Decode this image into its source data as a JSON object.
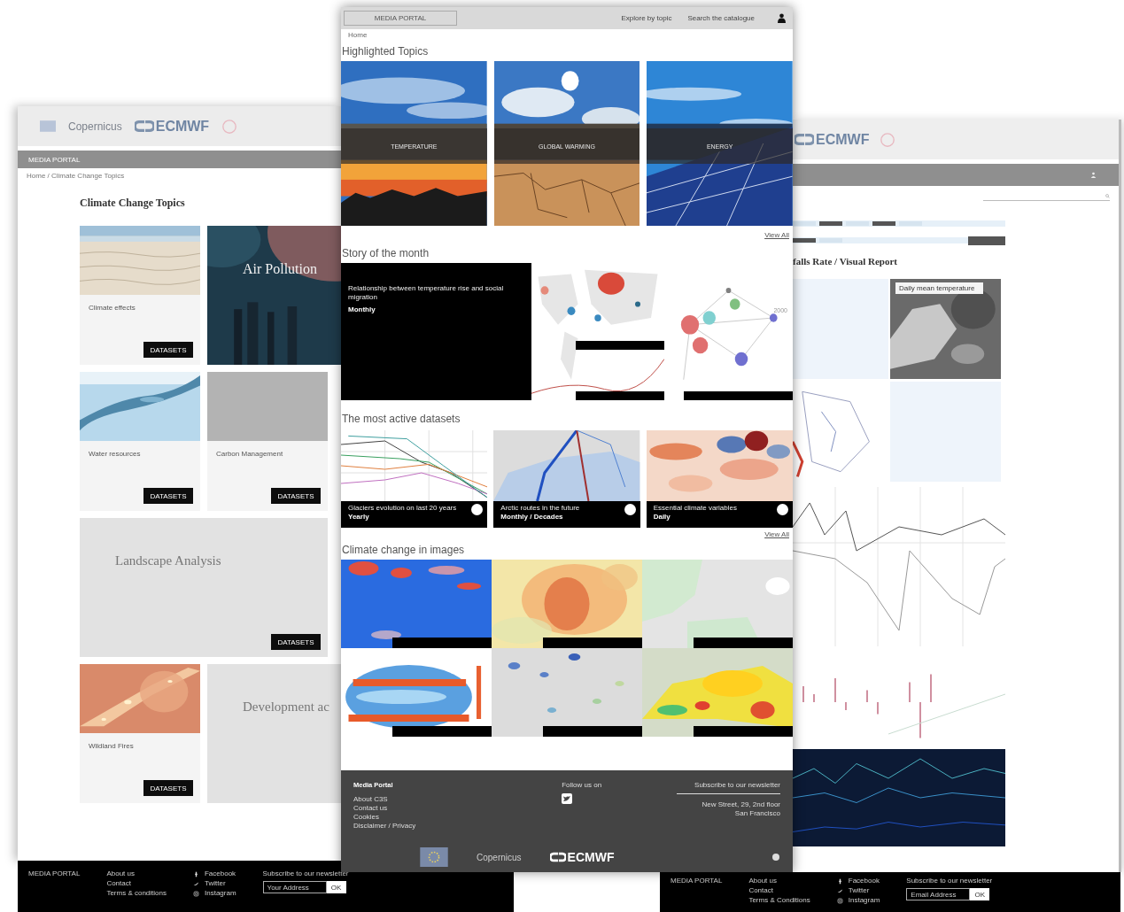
{
  "left_page": {
    "logos": [
      "Copernicus",
      "ECMWF"
    ],
    "nav": "MEDIA PORTAL",
    "breadcrumb": "Home / Climate Change Topics",
    "title": "Climate Change Topics",
    "cards": [
      {
        "title": "Climate effects",
        "button": "DATASETS"
      },
      {
        "kind": "feature",
        "title": "Air Pollution"
      },
      {
        "title": "Water resources",
        "button": "DATASETS"
      },
      {
        "kind": "placeholder",
        "title": "Carbon Management",
        "button": "DATASETS"
      },
      {
        "kind": "wide",
        "title": "Landscape Analysis",
        "button": "DATASETS"
      },
      {
        "title": "Wildland Fires",
        "button": "DATASETS"
      },
      {
        "kind": "feature",
        "title": "Development ac"
      }
    ],
    "footer": {
      "brand": "MEDIA PORTAL",
      "links": [
        "About us",
        "Contact",
        "Terms & conditions"
      ],
      "social": [
        {
          "kind": "facebook",
          "label": "Facebook"
        },
        {
          "kind": "twitter",
          "label": "Twitter"
        },
        {
          "kind": "instagram",
          "label": "Instagram"
        }
      ],
      "newsletter": {
        "label": "Subscribe to our newsletter",
        "placeholder": "Your Address",
        "button": "OK"
      }
    }
  },
  "center_page": {
    "logo": "MEDIA PORTAL",
    "nav": [
      "Explore by topic",
      "Search the catalogue"
    ],
    "breadcrumb": "Home",
    "highlighted": {
      "title": "Highlighted Topics",
      "topics": [
        "TEMPERATURE",
        "GLOBAL WARMING",
        "ENERGY"
      ],
      "view_all": "View All"
    },
    "story": {
      "title": "Story of the month",
      "headline": "Relationship between temperature rise and social migration",
      "frequency": "Monthly",
      "graph_label": "2000"
    },
    "datasets": {
      "title": "The most active datasets",
      "view_all": "View All",
      "items": [
        {
          "title": "Glaciers evolution on last 20 years",
          "frequency": "Yearly"
        },
        {
          "title": "Arctic routes in the future",
          "frequency": "Monthly / Decades"
        },
        {
          "title": "Essential climate variables",
          "frequency": "Daily"
        }
      ]
    },
    "images": {
      "title": "Climate change in images"
    },
    "footer": {
      "title": "Media Portal",
      "links": [
        "About C3S",
        "Contact us",
        "Cookies",
        "Disclaimer / Privacy"
      ],
      "follow": "Follow us on",
      "newsletter": "Subscribe to our newsletter",
      "address": [
        "New Street, 29, 2nd floor",
        "San Francisco"
      ],
      "logos": [
        "Copernicus",
        "ECMWF"
      ]
    }
  },
  "right_page": {
    "logo": "ECMWF",
    "title": "falls Rate / Visual Report",
    "map_label": "Daily mean temperature",
    "footer": {
      "brand": "MEDIA PORTAL",
      "links": [
        "About us",
        "Contact",
        "Terms & Conditions"
      ],
      "social": [
        {
          "kind": "facebook",
          "label": "Facebook"
        },
        {
          "kind": "twitter",
          "label": "Twitter"
        },
        {
          "kind": "instagram",
          "label": "Instagram"
        }
      ],
      "newsletter": {
        "label": "Subscribe to our newsletter",
        "placeholder": "Email Address",
        "button": "OK"
      }
    }
  }
}
